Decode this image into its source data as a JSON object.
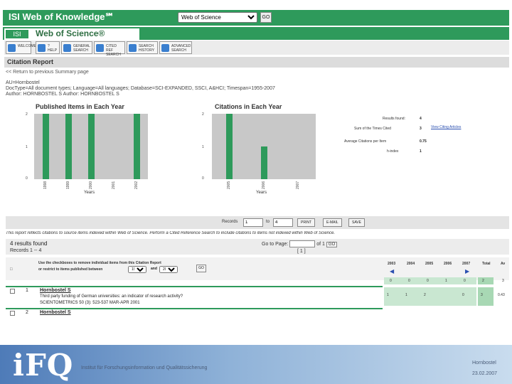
{
  "header": {
    "title": "ISI Web of Knowledge℠",
    "db_select": "Web of Science",
    "go_label": "GO"
  },
  "wos": {
    "logo_text": "ISI",
    "name": "Web of Science®"
  },
  "toolbar": [
    {
      "label": "WELCOME"
    },
    {
      "label": "? HELP"
    },
    {
      "label": "GENERAL SEARCH"
    },
    {
      "label": "CITED REF SEARCH"
    },
    {
      "label": "SEARCH HISTORY"
    },
    {
      "label": "ADVANCED SEARCH"
    }
  ],
  "report": {
    "heading": "Citation Report",
    "return_link": "<< Return to previous Summary page",
    "author": "AU=Hornbostel",
    "query_line": "DocType=All document types; Language=All languages; Database=SCI-EXPANDED, SSCI, A&HCI; Timespan=1955-2007",
    "author_line": "Author: HORNBOSTEL S   Author: HORNBOSTEL S"
  },
  "chart_pub": {
    "title": "Published Items in Each Year",
    "xlabel": "Years",
    "y_ticks": [
      "2",
      "1",
      "0"
    ],
    "years": [
      "1998",
      "1999",
      "2000",
      "2001",
      "2002"
    ],
    "values": [
      2,
      2,
      2,
      0,
      2
    ]
  },
  "chart_cit": {
    "title": "Citations in Each Year",
    "xlabel": "Years",
    "y_ticks": [
      "2",
      "1",
      "0"
    ],
    "years": [
      "2005",
      "2006",
      "2007"
    ],
    "values": [
      2,
      1,
      0
    ]
  },
  "stats": {
    "results_found_label": "Results found:",
    "results_found": "4",
    "sum_label": "Sum of the Times Cited",
    "sum": "3",
    "view_link": "View Citing Articles",
    "avg_label": "Average Citations per Item",
    "avg": "0.75",
    "h_label": "h-index",
    "h": "1"
  },
  "records": {
    "label": "Records",
    "from": "1",
    "to_label": "to",
    "to": "4",
    "print": "PRINT",
    "email": "E-MAIL",
    "save": "SAVE"
  },
  "note": "This report reflects citations to source items indexed within Web of Science. Perform a Cited Reference Search to include citations to items not indexed within Web of Science.",
  "results": {
    "found": "4 results found",
    "sort": "Records 1 -- 4",
    "goto_label": "Go to Page:",
    "of_label": "of 1",
    "go": "GO",
    "pager": "[ 1 ]"
  },
  "filter": {
    "line1": "Use the checkboxes to remove individual items from this Citation Report",
    "line2": "or restrict to items published between",
    "from_year": "1955",
    "and_label": "and",
    "to_year": "2007",
    "go": "GO"
  },
  "year_cols": [
    "2003",
    "2004",
    "2005",
    "2006",
    "2007",
    "Total",
    "Av"
  ],
  "totals": [
    "0",
    "0",
    "0",
    "1",
    "0",
    "2",
    "3"
  ],
  "rows": [
    {
      "idx": "1",
      "author": "Hornbostel S",
      "title": "Third party funding of German universities: an indicator of research activity?",
      "source": "SCIENTOMETRICS 50 (3): 523-537 MAR-APR 2001",
      "values": [
        "1",
        "1",
        "2",
        "",
        "0",
        "3",
        "0.43"
      ]
    },
    {
      "idx": "2",
      "author": "Hornbostel S",
      "title": "",
      "source": "",
      "values": []
    }
  ],
  "footer": {
    "logo": "iFQ",
    "institute": "Institut für Forschungsinformation und Qualitätssicherung",
    "author": "Hornbostel",
    "date": "23.02.2007"
  }
}
